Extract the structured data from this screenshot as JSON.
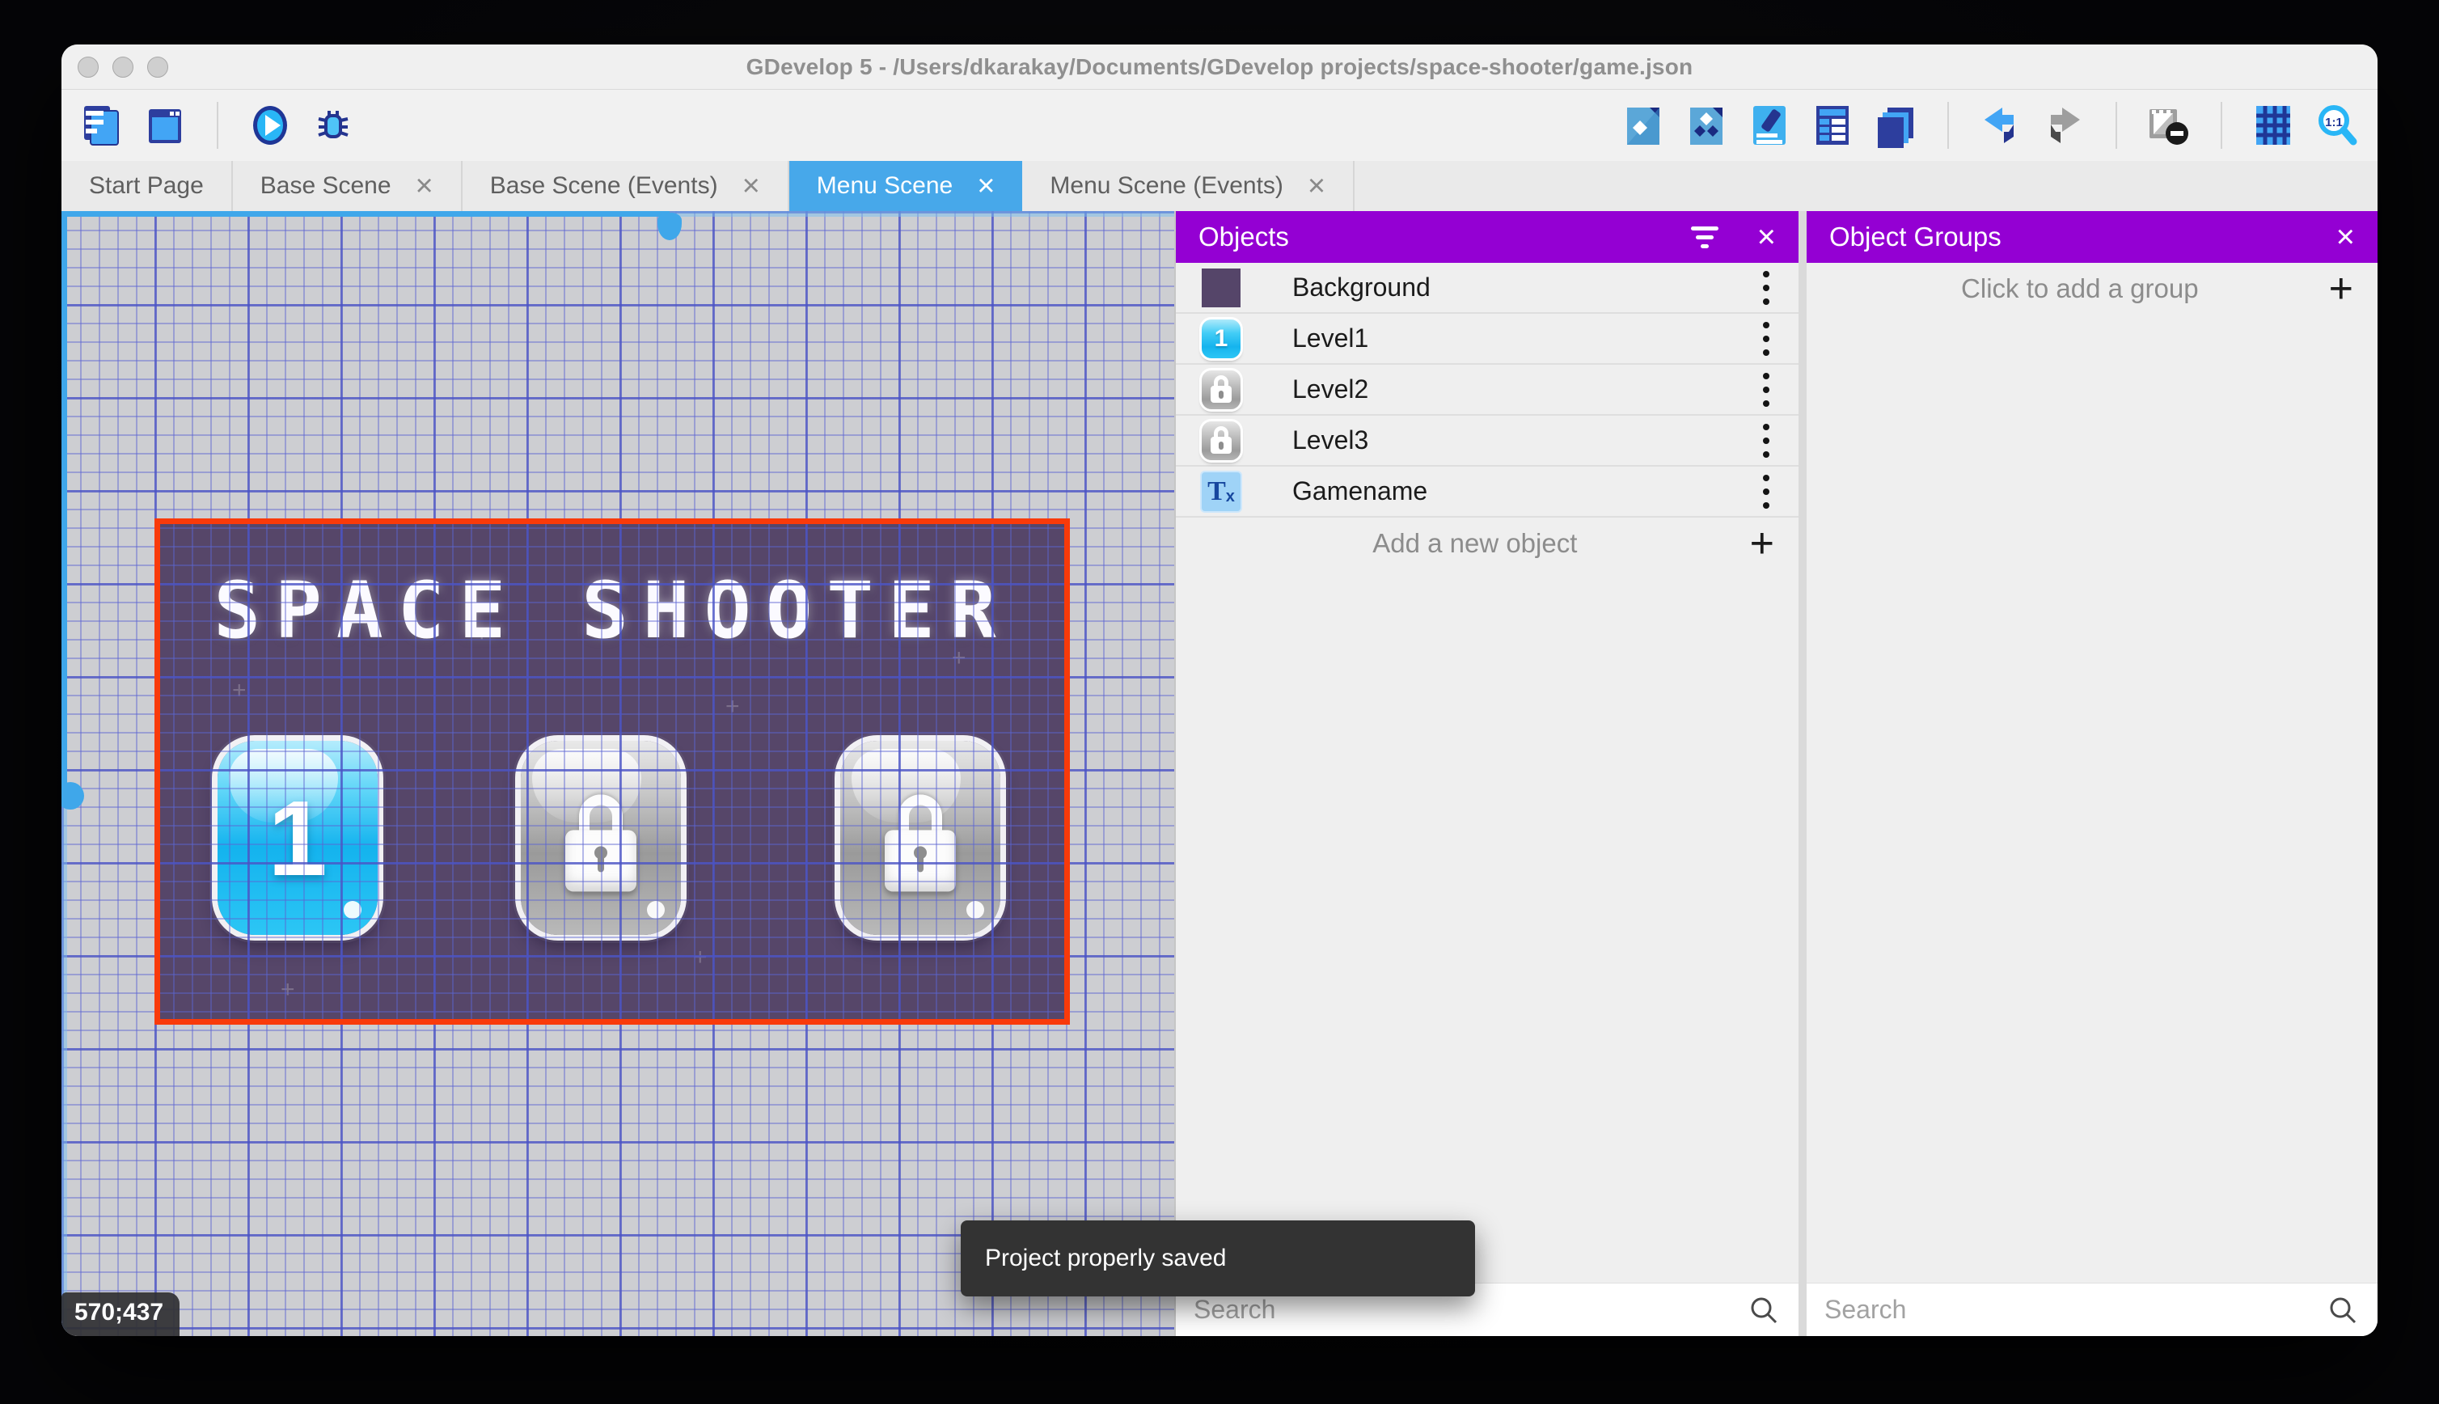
{
  "window": {
    "title": "GDevelop 5 - /Users/dkarakay/Documents/GDevelop projects/space-shooter/game.json",
    "traffic_lights": [
      "close",
      "minimize",
      "zoom"
    ]
  },
  "toolbar": {
    "left_icons": [
      "project-manager-icon",
      "app-window-icon",
      "preview-play-icon",
      "debug-icon"
    ],
    "right_icons": [
      "objects-editor-icon",
      "object-groups-icon",
      "properties-icon",
      "instances-list-icon",
      "layers-icon",
      "undo-icon",
      "redo-icon",
      "render-mask-icon",
      "grid-icon",
      "zoom-1-1-icon"
    ]
  },
  "tabs": [
    {
      "label": "Start Page",
      "active": false,
      "closable": false
    },
    {
      "label": "Base Scene",
      "active": false,
      "closable": true
    },
    {
      "label": "Base Scene (Events)",
      "active": false,
      "closable": true
    },
    {
      "label": "Menu Scene",
      "active": true,
      "closable": true
    },
    {
      "label": "Menu Scene (Events)",
      "active": false,
      "closable": true
    }
  ],
  "canvas": {
    "coordinates": "570;437",
    "scene": {
      "title": "SPACE SHOOTER",
      "buttons": [
        {
          "label": "1",
          "locked": false
        },
        {
          "label": "",
          "locked": true
        },
        {
          "label": "",
          "locked": true
        }
      ]
    }
  },
  "objects_panel": {
    "title": "Objects",
    "items": [
      {
        "name": "Background",
        "icon": "background-thumbnail",
        "badge": ""
      },
      {
        "name": "Level1",
        "icon": "level1-button-thumbnail",
        "badge": "1"
      },
      {
        "name": "Level2",
        "icon": "locked-button-thumbnail",
        "badge": ""
      },
      {
        "name": "Level3",
        "icon": "locked-button-thumbnail",
        "badge": ""
      },
      {
        "name": "Gamename",
        "icon": "text-object-thumbnail",
        "badge": ""
      }
    ],
    "add_label": "Add a new object",
    "search_placeholder": "Search"
  },
  "groups_panel": {
    "title": "Object Groups",
    "empty_label": "Click to add a group",
    "search_placeholder": "Search"
  },
  "toast": {
    "message": "Project properly saved"
  },
  "glyphs": {
    "close": "×",
    "plus": "+",
    "text_icon_main": "T",
    "text_icon_sub": "x"
  },
  "colors": {
    "accent_blue": "#47a8ea",
    "panel_header_purple": "#9400d3",
    "selection_red": "#f93a0a",
    "scene_purple": "#564669",
    "canvas_gray": "#cdced2",
    "toast_dark": "#333333"
  }
}
